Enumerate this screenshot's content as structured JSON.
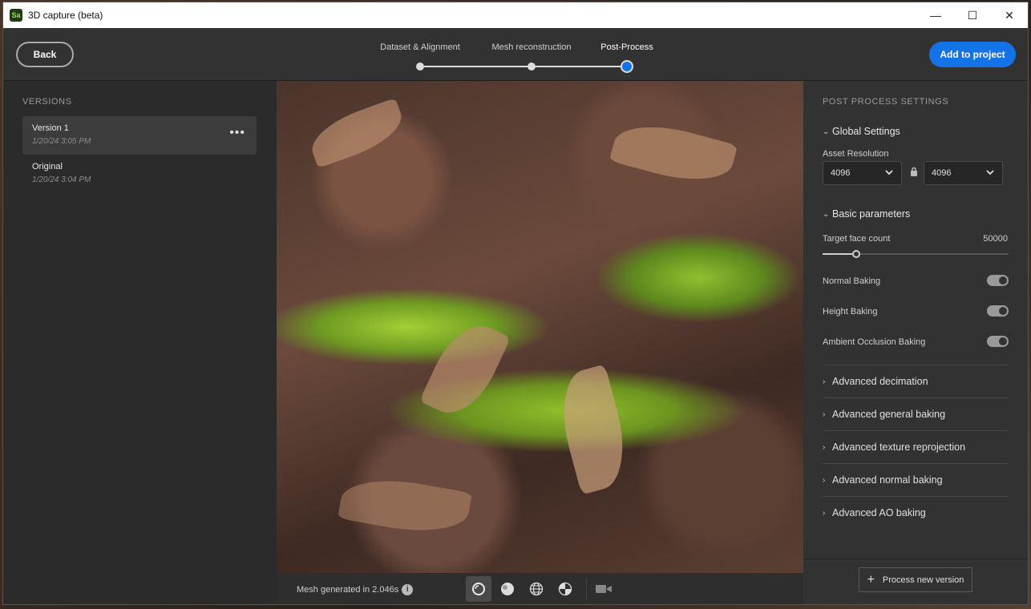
{
  "window": {
    "app_icon_text": "Sa",
    "title": "3D capture (beta)",
    "minimize": "—",
    "maximize": "☐",
    "close": "✕"
  },
  "header": {
    "back_label": "Back",
    "steps": [
      {
        "label": "Dataset & Alignment",
        "state": "done"
      },
      {
        "label": "Mesh reconstruction",
        "state": "done"
      },
      {
        "label": "Post-Process",
        "state": "active"
      }
    ],
    "add_label": "Add to project",
    "accent_color": "#1473e6"
  },
  "versions": {
    "title": "VERSIONS",
    "items": [
      {
        "name": "Version 1",
        "date": "1/20/24 3:05 PM",
        "selected": true,
        "more": "•••"
      },
      {
        "name": "Original",
        "date": "1/20/24 3:04 PM",
        "selected": false
      }
    ]
  },
  "viewport": {
    "status": "Mesh generated in 2.046s",
    "info_icon": "i",
    "view_modes": [
      "solid-shading-icon",
      "matcap-sphere-icon",
      "wireframe-globe-icon",
      "uv-checker-icon",
      "camera-icon"
    ]
  },
  "settings": {
    "title": "POST PROCESS SETTINGS",
    "global": {
      "label": "Global Settings",
      "asset_resolution_label": "Asset Resolution",
      "res_width": "4096",
      "res_height": "4096"
    },
    "basic": {
      "label": "Basic parameters",
      "target_face_label": "Target face count",
      "target_face_value": "50000",
      "target_face_fraction": 0.18,
      "normal_baking_label": "Normal Baking",
      "height_baking_label": "Height Baking",
      "ao_baking_label": "Ambient Occlusion Baking"
    },
    "advanced": [
      {
        "label": "Advanced decimation"
      },
      {
        "label": "Advanced general baking"
      },
      {
        "label": "Advanced texture reprojection"
      },
      {
        "label": "Advanced normal baking"
      },
      {
        "label": "Advanced AO baking"
      }
    ],
    "process_label": "Process new version"
  }
}
